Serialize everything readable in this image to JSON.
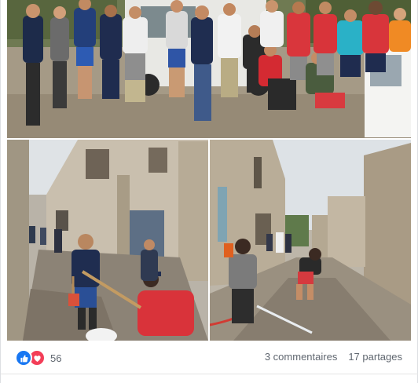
{
  "post": {
    "reaction_types": [
      "like-icon",
      "love-icon"
    ],
    "reaction_count": "56",
    "comments_label": "3 commentaires",
    "shares_label": "17 partages",
    "colors": {
      "like": "#1877f2",
      "love": "#f33e58",
      "meta_text": "#606770"
    }
  }
}
